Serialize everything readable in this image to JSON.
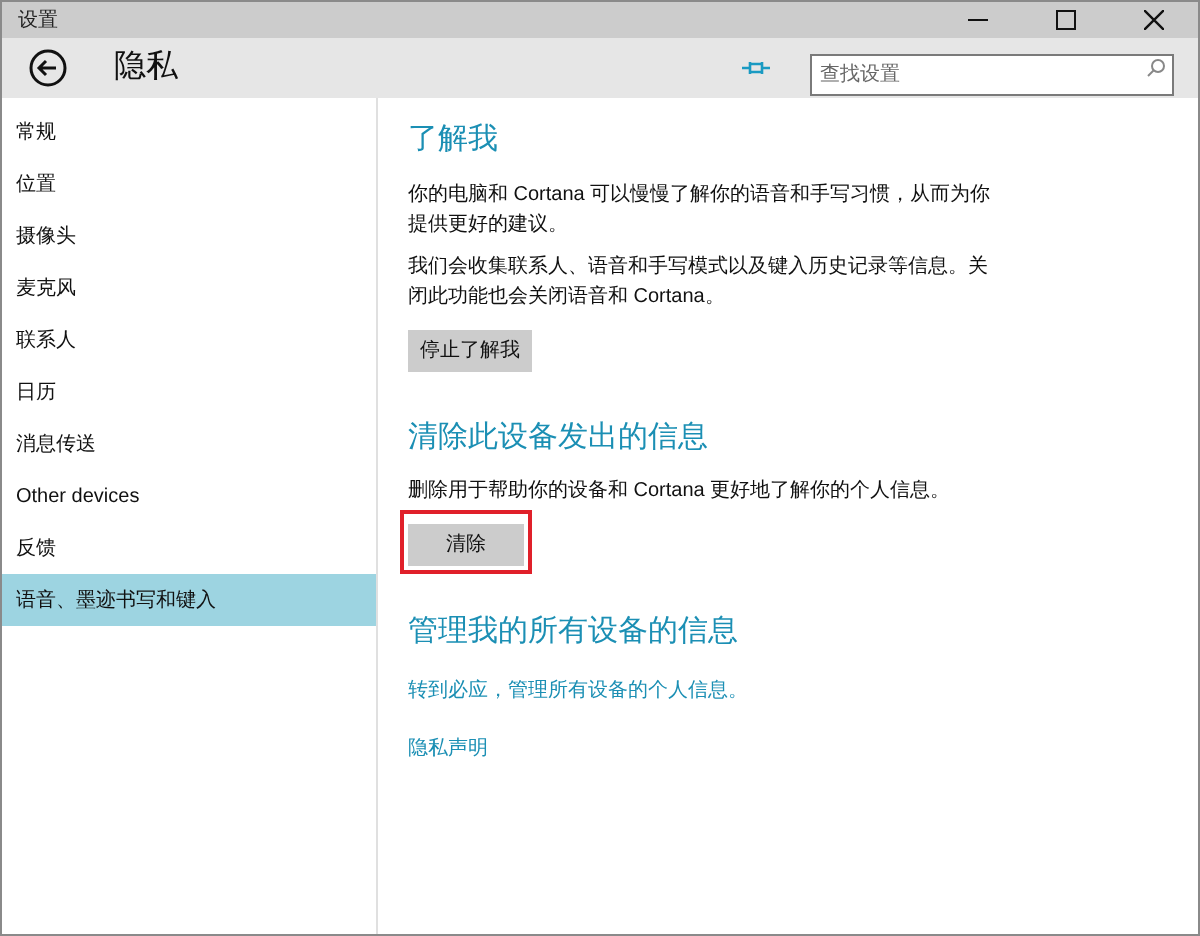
{
  "window": {
    "title": "设置"
  },
  "header": {
    "title": "隐私",
    "search": {
      "placeholder": "查找设置"
    }
  },
  "sidebar": {
    "items": [
      {
        "label": "常规",
        "selected": false
      },
      {
        "label": "位置",
        "selected": false
      },
      {
        "label": "摄像头",
        "selected": false
      },
      {
        "label": "麦克风",
        "selected": false
      },
      {
        "label": "联系人",
        "selected": false
      },
      {
        "label": "日历",
        "selected": false
      },
      {
        "label": "消息传送",
        "selected": false
      },
      {
        "label": "Other devices",
        "selected": false
      },
      {
        "label": "反馈",
        "selected": false
      },
      {
        "label": "语音、墨迹书写和键入",
        "selected": true
      }
    ]
  },
  "sections": [
    {
      "heading": "了解我",
      "paragraphs": [
        "你的电脑和 Cortana 可以慢慢了解你的语音和手写习惯，从而为你提供更好的建议。",
        "我们会收集联系人、语音和手写模式以及键入历史记录等信息。关闭此功能也会关闭语音和 Cortana。"
      ],
      "button": {
        "label": "停止了解我",
        "highlighted": false
      }
    },
    {
      "heading": "清除此设备发出的信息",
      "paragraphs": [
        "删除用于帮助你的设备和 Cortana 更好地了解你的个人信息。"
      ],
      "button": {
        "label": "清除",
        "highlighted": true
      }
    },
    {
      "heading": "管理我的所有设备的信息",
      "links": [
        "转到必应，管理所有设备的个人信息。",
        "隐私声明"
      ]
    }
  ]
}
